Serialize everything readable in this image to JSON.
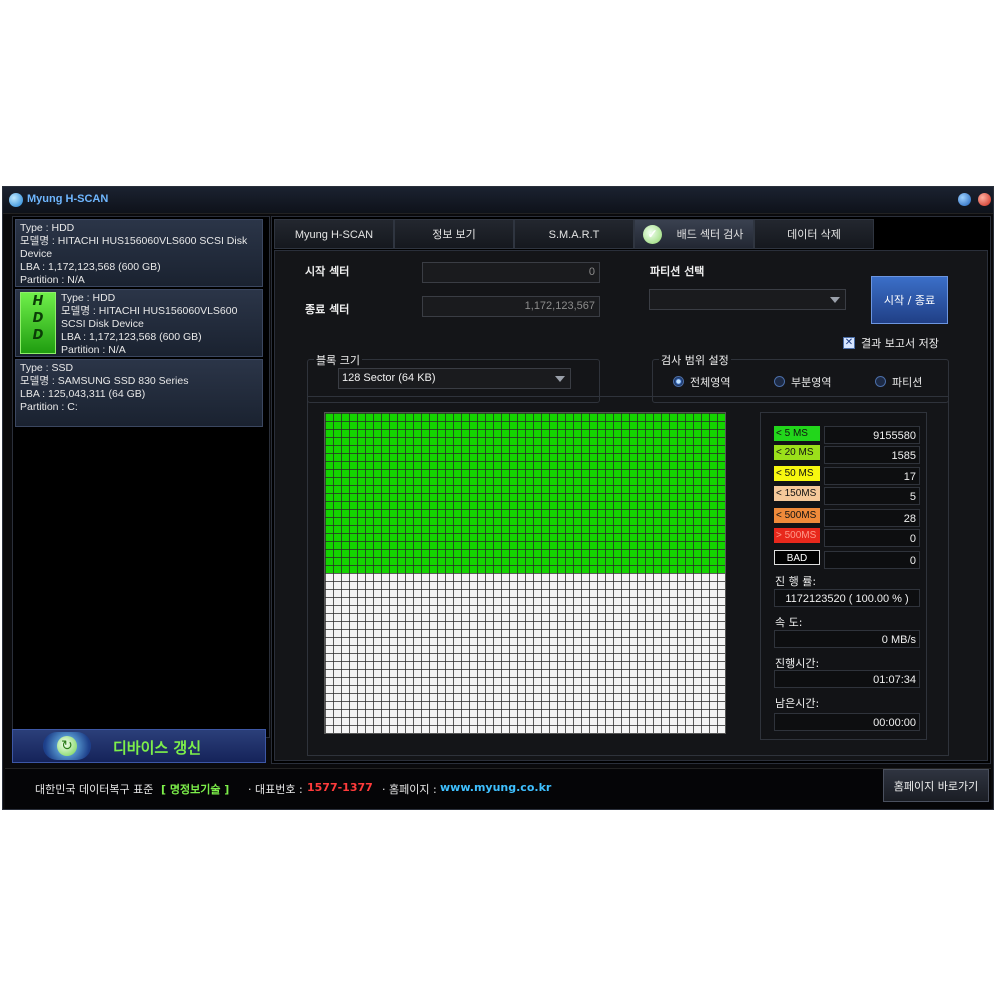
{
  "window": {
    "title": "Myung H-SCAN"
  },
  "devices": [
    {
      "type": "Type : HDD",
      "model": "모델명 : HITACHI HUS156060VLS600 SCSI Disk Device",
      "lba": "LBA : 1,172,123,568  (600 GB)",
      "partition": "Partition : N/A"
    },
    {
      "type": "Type : HDD",
      "model": "모델명 : HITACHI HUS156060VLS600 SCSI Disk Device",
      "lba": "LBA : 1,172,123,568  (600 GB)",
      "partition": "Partition : N/A",
      "icon_text": "HDD"
    },
    {
      "type": "Type : SSD",
      "model": "모델명 : SAMSUNG SSD 830 Series",
      "lba": "LBA : 125,043,311  (64 GB)",
      "partition": "Partition : C:"
    }
  ],
  "refresh": {
    "label": "디바이스 갱신"
  },
  "tabs": [
    {
      "label": "Myung H-SCAN"
    },
    {
      "label": "정보 보기"
    },
    {
      "label": "S.M.A.R.T"
    },
    {
      "label": "배드 섹터 검사",
      "active": true
    },
    {
      "label": "데이터 삭제"
    }
  ],
  "form": {
    "start_sector_label": "시작 섹터",
    "start_sector_value": "0",
    "end_sector_label": "종료 섹터",
    "end_sector_value": "1,172,123,567",
    "partition_label": "파티션 선택",
    "partition_value": "",
    "start_button": "시작 / 종료",
    "report_save_label": "결과 보고서 저장",
    "report_save_checked": true,
    "block_size_title": "블록 크기",
    "block_size_value": "128 Sector (64 KB)",
    "range_title": "검사 범위 설정",
    "range_options": [
      {
        "label": "전체영역",
        "selected": true
      },
      {
        "label": "부분영역",
        "selected": false
      },
      {
        "label": "파티션",
        "selected": false
      }
    ]
  },
  "scan_grid": {
    "completed_fraction": 0.5,
    "done_color": "#14d400",
    "pending_color": "#f4f4f4"
  },
  "legend": [
    {
      "label": "<  5 MS",
      "count": "9155580",
      "color": "#22d61b",
      "text_color": "#111111"
    },
    {
      "label": "< 20 MS",
      "count": "1585",
      "color": "#9be01a",
      "text_color": "#111111"
    },
    {
      "label": "< 50 MS",
      "count": "17",
      "color": "#f7f70f",
      "text_color": "#111111"
    },
    {
      "label": "< 150MS",
      "count": "5",
      "color": "#f5c89a",
      "text_color": "#111111"
    },
    {
      "label": "< 500MS",
      "count": "28",
      "color": "#f08a3a",
      "text_color": "#111111"
    },
    {
      "label": "> 500MS",
      "count": "0",
      "color": "#e8281c",
      "text_color": "#ff9a8a"
    },
    {
      "label": "BAD",
      "count": "0",
      "color": "#000000",
      "text_color": "#ffffff"
    }
  ],
  "stats": {
    "progress_label": "진 행 률:",
    "progress_value": "1172123520 ( 100.00 % )",
    "speed_label": "속      도:",
    "speed_value": "0 MB/s",
    "elapsed_label": "진행시간:",
    "elapsed_value": "01:07:34",
    "remaining_label": "남은시간:",
    "remaining_value": "00:00:00"
  },
  "footer": {
    "slogan_prefix": "대한민국 데이터복구 표준",
    "brand": "[ 명정보기술 ]",
    "phone_label": "· 대표번호 :",
    "phone": "1577-1377",
    "homepage_label": "· 홈페이지 :",
    "homepage": "www.myung.co.kr",
    "home_button": "홈페이지 바로가기"
  }
}
